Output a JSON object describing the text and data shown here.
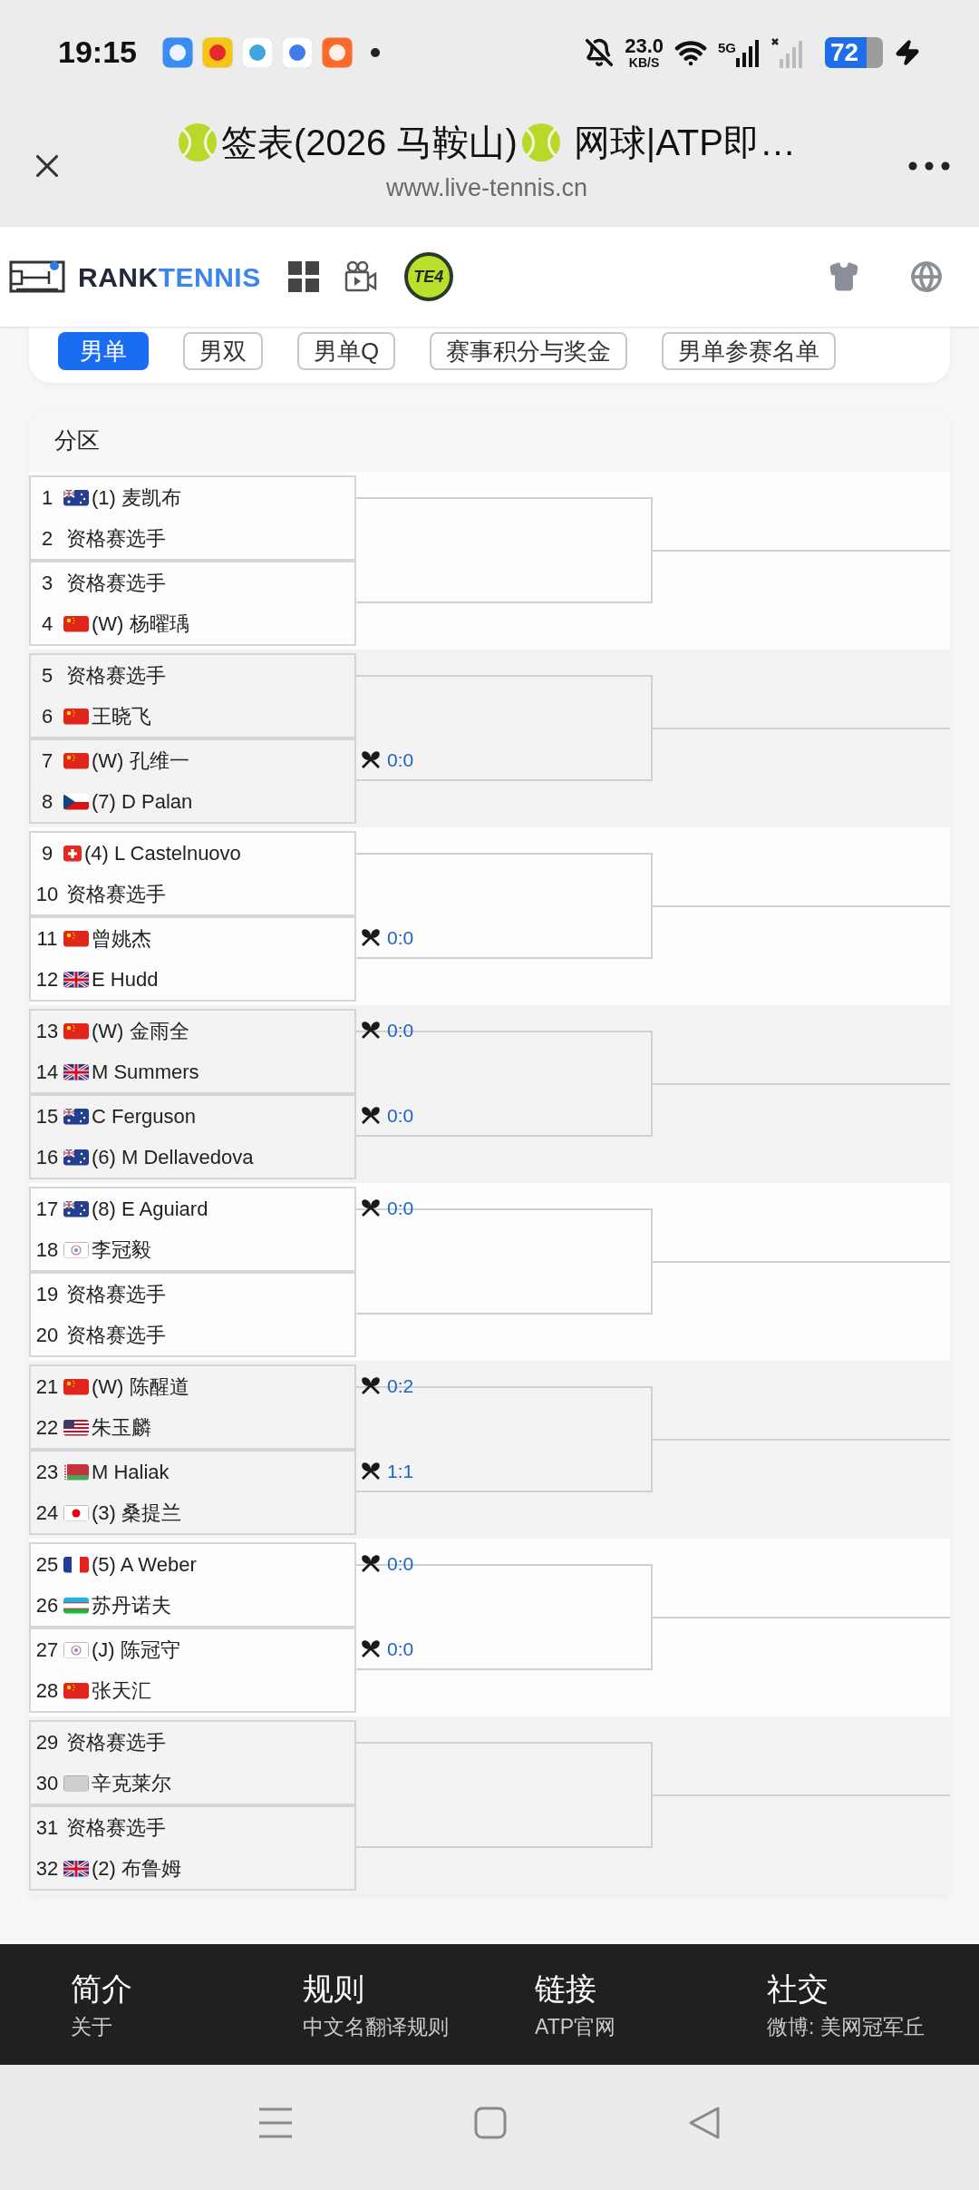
{
  "status_bar": {
    "time": "19:15",
    "net_speed": "23.0",
    "net_unit": "KB/S",
    "network": "5G",
    "battery": "72"
  },
  "browser": {
    "title": "签表(2026 马鞍山)",
    "title_suffix": "网球|ATP即…",
    "url": "www.live-tennis.cn"
  },
  "site_header": {
    "brand_left": "RANK",
    "brand_right": "TENNIS",
    "badge": "TE4"
  },
  "tabs": [
    {
      "label": "男单",
      "selected": true
    },
    {
      "label": "男双",
      "selected": false
    },
    {
      "label": "男单Q",
      "selected": false
    },
    {
      "label": "赛事积分与奖金",
      "selected": false
    },
    {
      "label": "男单参赛名单",
      "selected": false
    }
  ],
  "draw": {
    "title": "分区",
    "sections": [
      {
        "pairs": [
          {
            "players": [
              {
                "no": "1",
                "kind": "au",
                "name": "(1) 麦凯布"
              },
              {
                "no": "2",
                "kind": "none",
                "name": "资格赛选手"
              }
            ]
          },
          {
            "players": [
              {
                "no": "3",
                "kind": "none",
                "name": "资格赛选手"
              },
              {
                "no": "4",
                "kind": "cn",
                "name": "(W) 杨曜瑀"
              }
            ]
          }
        ]
      },
      {
        "pairs": [
          {
            "players": [
              {
                "no": "5",
                "kind": "none",
                "name": "资格赛选手"
              },
              {
                "no": "6",
                "kind": "cn",
                "name": "王晓飞"
              }
            ]
          },
          {
            "score": "0:0",
            "players": [
              {
                "no": "7",
                "kind": "cn",
                "name": "(W) 孔维一"
              },
              {
                "no": "8",
                "kind": "cz",
                "name": "(7) D Palan"
              }
            ]
          }
        ]
      },
      {
        "pairs": [
          {
            "players": [
              {
                "no": "9",
                "kind": "ch",
                "name": "(4) L Castelnuovo"
              },
              {
                "no": "10",
                "kind": "none",
                "name": "资格赛选手"
              }
            ]
          },
          {
            "score": "0:0",
            "players": [
              {
                "no": "11",
                "kind": "cn",
                "name": "曾姚杰"
              },
              {
                "no": "12",
                "kind": "gb",
                "name": "E Hudd"
              }
            ]
          }
        ]
      },
      {
        "pairs": [
          {
            "score": "0:0",
            "players": [
              {
                "no": "13",
                "kind": "cn",
                "name": "(W) 金雨全"
              },
              {
                "no": "14",
                "kind": "gb",
                "name": "M Summers"
              }
            ]
          },
          {
            "score": "0:0",
            "players": [
              {
                "no": "15",
                "kind": "au",
                "name": "C Ferguson"
              },
              {
                "no": "16",
                "kind": "au",
                "name": "(6) M Dellavedova"
              }
            ]
          }
        ]
      },
      {
        "pairs": [
          {
            "score": "0:0",
            "players": [
              {
                "no": "17",
                "kind": "au",
                "name": "(8) E Aguiard"
              },
              {
                "no": "18",
                "kind": "tpe",
                "name": "李冠毅"
              }
            ]
          },
          {
            "players": [
              {
                "no": "19",
                "kind": "none",
                "name": "资格赛选手"
              },
              {
                "no": "20",
                "kind": "none",
                "name": "资格赛选手"
              }
            ]
          }
        ]
      },
      {
        "pairs": [
          {
            "score": "0:2",
            "players": [
              {
                "no": "21",
                "kind": "cn",
                "name": "(W) 陈醒道"
              },
              {
                "no": "22",
                "kind": "us",
                "name": "朱玉麟"
              }
            ]
          },
          {
            "score": "1:1",
            "players": [
              {
                "no": "23",
                "kind": "by",
                "name": "M Haliak"
              },
              {
                "no": "24",
                "kind": "jp",
                "name": "(3) 桑提兰"
              }
            ]
          }
        ]
      },
      {
        "pairs": [
          {
            "score": "0:0",
            "players": [
              {
                "no": "25",
                "kind": "fr",
                "name": "(5) A Weber"
              },
              {
                "no": "26",
                "kind": "uz",
                "name": "苏丹诺夫"
              }
            ]
          },
          {
            "score": "0:0",
            "players": [
              {
                "no": "27",
                "kind": "tpe",
                "name": "(J) 陈冠守"
              },
              {
                "no": "28",
                "kind": "cn",
                "name": "张天汇"
              }
            ]
          }
        ]
      },
      {
        "pairs": [
          {
            "players": [
              {
                "no": "29",
                "kind": "none",
                "name": "资格赛选手"
              },
              {
                "no": "30",
                "kind": "unknown",
                "name": "辛克莱尔"
              }
            ]
          },
          {
            "players": [
              {
                "no": "31",
                "kind": "none",
                "name": "资格赛选手"
              },
              {
                "no": "32",
                "kind": "gb",
                "name": "(2) 布鲁姆"
              }
            ]
          }
        ]
      }
    ]
  },
  "footer": [
    {
      "title": "简介",
      "link": "关于"
    },
    {
      "title": "规则",
      "link": "中文名翻译规则"
    },
    {
      "title": "链接",
      "link": "ATP官网"
    },
    {
      "title": "社交",
      "link": "微博: 美网冠军丘"
    }
  ]
}
